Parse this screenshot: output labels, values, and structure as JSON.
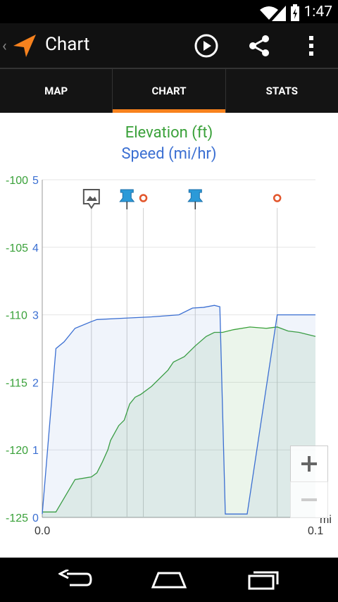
{
  "status_bar": {
    "time": "1:47"
  },
  "action_bar": {
    "title": "Chart"
  },
  "tabs": [
    {
      "label": "MAP"
    },
    {
      "label": "CHART"
    },
    {
      "label": "STATS"
    }
  ],
  "chart": {
    "legend_elevation": "Elevation (ft)",
    "legend_speed": "Speed (mi/hr)",
    "x_unit": "mi"
  },
  "chart_data": {
    "type": "area",
    "series": [
      {
        "name": "Elevation (ft)",
        "color": "#3aa13a",
        "x": [
          0.0,
          0.005,
          0.012,
          0.018,
          0.02,
          0.022,
          0.024,
          0.025,
          0.028,
          0.03,
          0.032,
          0.034,
          0.036,
          0.04,
          0.046,
          0.048,
          0.052,
          0.056,
          0.06,
          0.063,
          0.066,
          0.07,
          0.076,
          0.082,
          0.086,
          0.09,
          0.094,
          0.1
        ],
        "y": [
          -124.6,
          -124.6,
          -122.2,
          -122.0,
          -121.7,
          -120.9,
          -120.0,
          -119.3,
          -118.2,
          -117.8,
          -116.6,
          -116.1,
          -115.9,
          -115.3,
          -114.1,
          -113.5,
          -113.1,
          -112.3,
          -111.6,
          -111.3,
          -111.3,
          -111.1,
          -110.9,
          -111.0,
          -110.9,
          -111.2,
          -111.3,
          -111.6
        ]
      },
      {
        "name": "Speed (mi/hr)",
        "color": "#3b6fd2",
        "x": [
          0.0,
          0.005,
          0.008,
          0.012,
          0.018,
          0.02,
          0.03,
          0.04,
          0.05,
          0.055,
          0.059,
          0.063,
          0.065,
          0.067,
          0.07,
          0.075,
          0.086,
          0.1
        ],
        "y": [
          0.05,
          2.5,
          2.6,
          2.8,
          2.9,
          2.93,
          2.95,
          2.97,
          3.0,
          3.1,
          3.11,
          3.14,
          3.12,
          0.05,
          0.05,
          0.05,
          3.0,
          3.0
        ]
      }
    ],
    "y_left_ticks": [
      "-100",
      "-105",
      "-110",
      "-115",
      "-120",
      "-125"
    ],
    "y_right_ticks": [
      "5",
      "4",
      "3",
      "2",
      "1",
      "0"
    ],
    "x_ticks": [
      "0.0",
      "0.1"
    ],
    "x_range": [
      0,
      0.1
    ],
    "y_left_range": [
      -125,
      -100
    ],
    "y_right_range": [
      0,
      5
    ],
    "markers": [
      {
        "type": "photo",
        "x": 0.018
      },
      {
        "type": "pin",
        "x": 0.031
      },
      {
        "type": "waypoint",
        "x": 0.037
      },
      {
        "type": "pin",
        "x": 0.056
      },
      {
        "type": "waypoint",
        "x": 0.086
      }
    ]
  },
  "zoom": {
    "in_label": "+",
    "out_label": "−"
  }
}
